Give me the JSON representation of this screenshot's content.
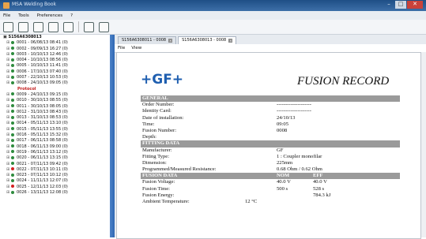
{
  "app": {
    "title": "MSA Welding Book"
  },
  "menu": [
    "File",
    "Tools",
    "Preferences",
    "?"
  ],
  "tree": {
    "root": "S156A6308013",
    "items": [
      {
        "label": "0001 - 06/08/13 08:41 (0)"
      },
      {
        "label": "0002 - 09/09/13 16:27 (0)"
      },
      {
        "label": "0003 - 10/10/13 12:46 (0)"
      },
      {
        "label": "0004 - 10/10/13 08:56 (0)"
      },
      {
        "label": "0005 - 10/10/13 11:41 (0)"
      },
      {
        "label": "0006 - 17/10/13 07:40 (0)"
      },
      {
        "label": "0007 - 22/10/13 10:53 (0)"
      },
      {
        "label": "0008 - 24/10/13 09:05 (0)"
      },
      {
        "label": "Protocol",
        "sub": true
      },
      {
        "label": "0009 - 24/10/13 09:15 (0)"
      },
      {
        "label": "0010 - 30/10/13 08:55 (0)"
      },
      {
        "label": "0011 - 30/10/13 08:05 (0)"
      },
      {
        "label": "0012 - 31/10/13 08:43 (0)"
      },
      {
        "label": "0013 - 31/10/13 08:53 (0)"
      },
      {
        "label": "0014 - 05/11/13 13:10 (0)"
      },
      {
        "label": "0015 - 05/11/13 13:55 (0)"
      },
      {
        "label": "0016 - 05/11/13 15:32 (0)"
      },
      {
        "label": "0017 - 06/11/13 08:58 (0)"
      },
      {
        "label": "0018 - 06/11/13 09:00 (0)"
      },
      {
        "label": "0019 - 06/11/13 13:12 (0)"
      },
      {
        "label": "0020 - 06/11/13 13:15 (0)"
      },
      {
        "label": "0021 - 07/11/13 09:42 (0)"
      },
      {
        "label": "0022 - 07/11/13 10:11 (0)",
        "red": true
      },
      {
        "label": "0023 - 07/11/13 10:12 (0)"
      },
      {
        "label": "0024 - 11/11/13 12:07 (0)"
      },
      {
        "label": "0025 - 12/11/13 12:03 (0)",
        "red": true
      },
      {
        "label": "0026 - 13/11/13 12:08 (0)"
      }
    ]
  },
  "tabs": [
    {
      "label": "S156A6308011 - 0008"
    },
    {
      "label": "S156A6308013 - 0008"
    }
  ],
  "viewmenu": [
    "File",
    "View"
  ],
  "doc": {
    "logo": "+GF+",
    "title": "FUSION RECORD",
    "rows": [
      {
        "type": "sec",
        "k": "GENERAL"
      },
      {
        "k": "Order Number:",
        "v": "--------------------"
      },
      {
        "k": "Identity Card:",
        "v": "--------------------"
      },
      {
        "k": "Date of installation:",
        "v": "24/10/13"
      },
      {
        "k": "Time:",
        "v": "09:05"
      },
      {
        "k": "Fusion Number:",
        "v": "0008"
      },
      {
        "k": "Depth:",
        "v": ""
      },
      {
        "type": "sec",
        "k": "FITTING DATA"
      },
      {
        "k": "Manufacturer:",
        "v": "GF"
      },
      {
        "k": "Fitting Type:",
        "v": "1   :  Coupler monofilar"
      },
      {
        "k": "Dimension:",
        "v": "225mm"
      },
      {
        "k": "Programmed/Measured Resistance:",
        "v": "0.68 Ohm / 0.62 Ohm"
      },
      {
        "type": "sec",
        "k": "FUSION DATA",
        "h1": "NOM",
        "h2": "EFF"
      },
      {
        "k": "Fusion Voltage:",
        "v": "40.0  V",
        "c2": "40.0  V"
      },
      {
        "k": "Fusion Time:",
        "v": "500 s",
        "c2": "528 s"
      },
      {
        "k": "Fusion Energy:",
        "v": "",
        "c2": "784.3 kJ"
      },
      {
        "k": "Ambient Temperature:",
        "c3": "12 °C"
      }
    ]
  }
}
